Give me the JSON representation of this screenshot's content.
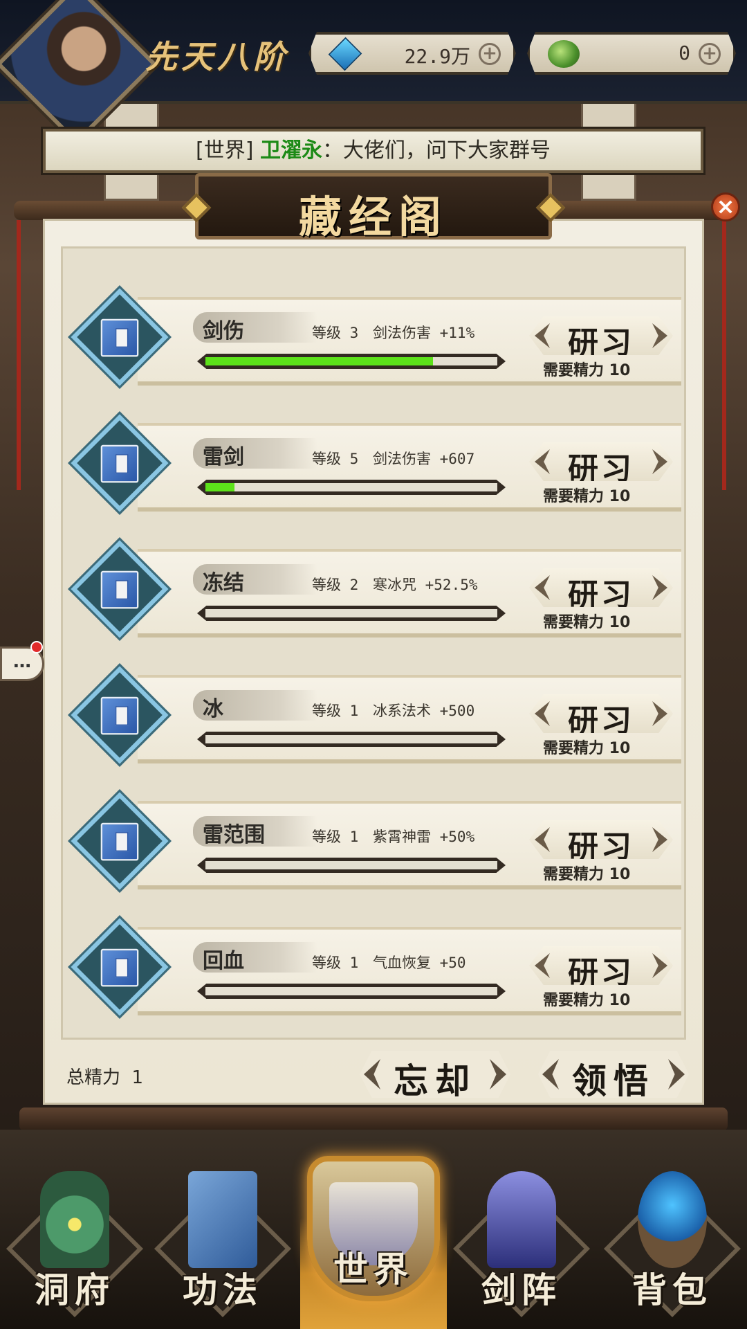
{
  "header": {
    "rank": "先天八阶",
    "currency_1": {
      "icon": "blue-gem-icon",
      "value": "22.9万"
    },
    "currency_2": {
      "icon": "jade-icon",
      "value": "0"
    }
  },
  "chat": {
    "channel": "[世界]",
    "sender": "卫濯永",
    "separator": "：",
    "message": "大佬们，问下大家群号"
  },
  "panel": {
    "title": "藏经阁",
    "skills": [
      {
        "name": "剑伤",
        "level_label": "等级",
        "level": "3",
        "effect": "剑法伤害 +11%",
        "progress": 0.78,
        "button": "研习",
        "cost": "需要精力 10"
      },
      {
        "name": "雷剑",
        "level_label": "等级",
        "level": "5",
        "effect": "剑法伤害 +607",
        "progress": 0.1,
        "button": "研习",
        "cost": "需要精力 10"
      },
      {
        "name": "冻结",
        "level_label": "等级",
        "level": "2",
        "effect": "寒冰咒 +52.5%",
        "progress": 0.0,
        "button": "研习",
        "cost": "需要精力 10"
      },
      {
        "name": "冰",
        "level_label": "等级",
        "level": "1",
        "effect": "冰系法术 +500",
        "progress": 0.0,
        "button": "研习",
        "cost": "需要精力 10"
      },
      {
        "name": "雷范围",
        "level_label": "等级",
        "level": "1",
        "effect": "紫霄神雷 +50%",
        "progress": 0.0,
        "button": "研习",
        "cost": "需要精力 10"
      },
      {
        "name": "回血",
        "level_label": "等级",
        "level": "1",
        "effect": "气血恢复 +50",
        "progress": 0.0,
        "button": "研习",
        "cost": "需要精力 10"
      }
    ],
    "total_label": "总精力",
    "total_value": "1",
    "forget_button": "忘却",
    "comprehend_button": "领悟"
  },
  "bubble": {
    "text": "…"
  },
  "nav": [
    {
      "label": "洞府",
      "icon": "cave-guardian-icon"
    },
    {
      "label": "功法",
      "icon": "scripture-book-icon"
    },
    {
      "label": "世界",
      "icon": "world-shield-icon",
      "active": true
    },
    {
      "label": "剑阵",
      "icon": "sword-array-icon"
    },
    {
      "label": "背包",
      "icon": "backpack-icon"
    }
  ],
  "colors": {
    "progress": "#5de21a",
    "sender": "#1c8a16",
    "accent_gold": "#e6c27a"
  }
}
